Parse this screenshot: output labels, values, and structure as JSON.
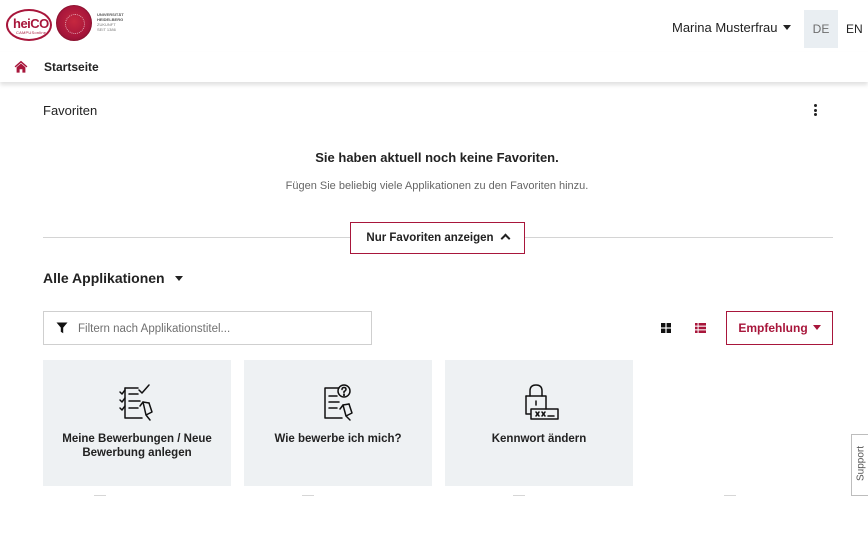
{
  "header": {
    "logo_text": "heiCO",
    "logo_subtext": "CAMPUSonline",
    "university_lines": [
      "UNIVERSITÄT",
      "HEIDELBERG",
      "ZUKUNFT",
      "SEIT 1386"
    ],
    "user_name": "Marina Musterfrau",
    "lang_de": "DE",
    "lang_en": "EN"
  },
  "breadcrumb": {
    "home_label": "Startseite"
  },
  "favorites": {
    "title": "Favoriten",
    "empty_heading": "Sie haben aktuell noch keine Favoriten.",
    "empty_text": "Fügen Sie beliebig viele Applikationen zu den Favoriten hinzu.",
    "toggle_label": "Nur Favoriten anzeigen"
  },
  "applications": {
    "title": "Alle Applikationen",
    "filter_placeholder": "Filtern nach Applikationstitel...",
    "sort_label": "Empfehlung",
    "tiles": [
      {
        "label": "Meine Bewerbungen / Neue Bewerbung anlegen",
        "icon": "application-checklist-icon"
      },
      {
        "label": "Wie bewerbe ich mich?",
        "icon": "application-question-icon"
      },
      {
        "label": "Kennwort ändern",
        "icon": "password-lock-icon"
      }
    ]
  },
  "support": {
    "label": "Support"
  },
  "colors": {
    "brand": "#a8163b",
    "tile_bg": "#eef1f3",
    "lang_active_bg": "#e9eef2"
  }
}
